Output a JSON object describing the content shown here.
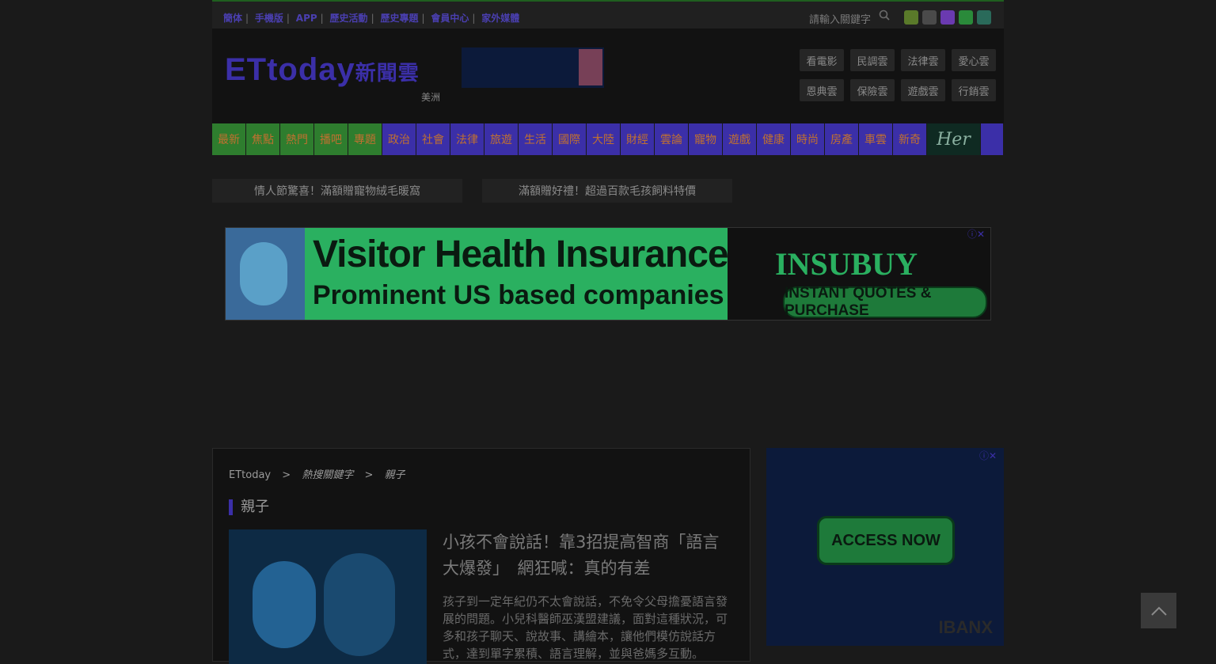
{
  "topbar": {
    "links": [
      "簡体",
      "手機版",
      "APP",
      "歷史活動",
      "歷史專題",
      "會員中心",
      "家外媒體"
    ],
    "search_placeholder": "請輸入關鍵字",
    "social_icons": [
      "facebook-icon",
      "youtube-icon",
      "instagram-icon",
      "rss-icon",
      "line-icon"
    ]
  },
  "header": {
    "logo": "ETtoday",
    "logo_cloud": "新聞雲",
    "region": "美洲",
    "cloud_links": [
      "看電影",
      "民調雲",
      "法律雲",
      "愛心雲",
      "恩典雲",
      "保險雲",
      "遊戲雲",
      "行銷雲"
    ]
  },
  "nav": {
    "green_items": [
      "最新",
      "焦點",
      "熱門",
      "播吧",
      "專題"
    ],
    "blue_items": [
      "政治",
      "社會",
      "法律",
      "旅遊",
      "生活",
      "國際",
      "大陸",
      "財經",
      "雲論",
      "寵物",
      "遊戲",
      "健康",
      "時尚",
      "房產",
      "車雲",
      "新奇"
    ],
    "her_label": "Her"
  },
  "promos": [
    "情人節驚喜！滿額贈寵物絨毛暖窩",
    "滿額贈好禮！超過百款毛孩飼料特價"
  ],
  "banner_ad": {
    "line1": "Visitor Health Insurance",
    "line2": "Prominent US based companies",
    "brand": "INSUBUY",
    "cta": "INSTANT QUOTES & PURCHASE",
    "ad_marks": "ⓘ✕"
  },
  "breadcrumb": {
    "home": "ETtoday",
    "sep": ">",
    "hot": "熱搜關鍵字",
    "current": "親子"
  },
  "section_title": "親子",
  "article": {
    "title": "小孩不會說話！靠3招提高智商「語言大爆發」　網狂喊：真的有差",
    "summary": "孩子到一定年紀仍不太會說話，不免令父母擔憂語言發展的問題。小兒科醫師巫漢盟建議，面對這種狀況，可多和孩子聊天、說故事、講繪本，讓他們模仿說話方式，達到單字累積、語言理解，並與爸媽多互動。"
  },
  "side_ad": {
    "cta": "ACCESS NOW",
    "brand": "IBANX",
    "ad_marks": "ⓘ✕"
  },
  "back_to_top": "︿"
}
